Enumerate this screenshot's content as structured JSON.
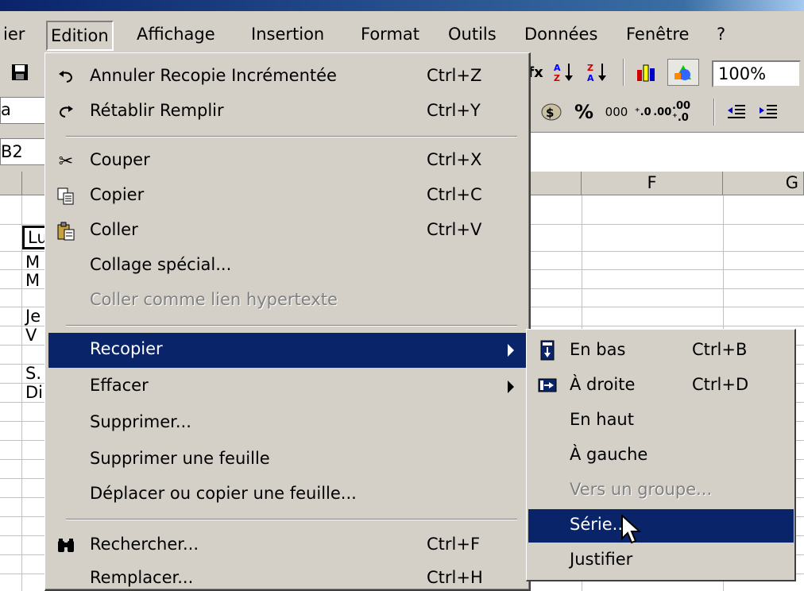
{
  "menubar": {
    "items": [
      "ier",
      "Edition",
      "Affichage",
      "Insertion",
      "Format",
      "Outils",
      "Données",
      "Fenêtre",
      "?"
    ]
  },
  "toolbar": {
    "zoom": "100%",
    "font_value": "a",
    "percent": "%",
    "thousands": "000",
    "dec_inc": "⁺.0 .00",
    "dec_dec": ".00 ⁺.0"
  },
  "namebox": {
    "value": "B2"
  },
  "columns": {
    "f": "F",
    "g": "G"
  },
  "cells": [
    "Lu",
    "M",
    "M",
    "Je",
    "V",
    "S.",
    "Di"
  ],
  "edit_menu": {
    "items": [
      {
        "label": "Annuler Recopie Incrémentée",
        "shortcut": "Ctrl+Z",
        "icon": "undo-icon"
      },
      {
        "label": "Rétablir Remplir",
        "shortcut": "Ctrl+Y",
        "icon": "redo-icon"
      },
      {
        "label": "Couper",
        "shortcut": "Ctrl+X",
        "icon": "scissors-icon"
      },
      {
        "label": "Copier",
        "shortcut": "Ctrl+C",
        "icon": "copy-icon"
      },
      {
        "label": "Coller",
        "shortcut": "Ctrl+V",
        "icon": "paste-icon"
      },
      {
        "label": "Collage spécial...",
        "shortcut": ""
      },
      {
        "label": "Coller comme lien hypertexte",
        "shortcut": "",
        "disabled": true
      },
      {
        "label": "Recopier",
        "shortcut": "",
        "submenu": true,
        "highlighted": true
      },
      {
        "label": "Effacer",
        "shortcut": "",
        "submenu": true
      },
      {
        "label": "Supprimer...",
        "shortcut": ""
      },
      {
        "label": "Supprimer une feuille",
        "shortcut": ""
      },
      {
        "label": "Déplacer ou copier une feuille...",
        "shortcut": ""
      },
      {
        "label": "Rechercher...",
        "shortcut": "Ctrl+F",
        "icon": "binoculars-icon"
      },
      {
        "label": "Remplacer...",
        "shortcut": "Ctrl+H"
      }
    ]
  },
  "fill_submenu": {
    "items": [
      {
        "label": "En bas",
        "shortcut": "Ctrl+B",
        "icon": "fill-down-icon"
      },
      {
        "label": "À droite",
        "shortcut": "Ctrl+D",
        "icon": "fill-right-icon"
      },
      {
        "label": "En haut",
        "shortcut": ""
      },
      {
        "label": "À gauche",
        "shortcut": ""
      },
      {
        "label": "Vers un groupe...",
        "shortcut": "",
        "disabled": true
      },
      {
        "label": "Série...",
        "shortcut": "",
        "highlighted": true
      },
      {
        "label": "Justifier",
        "shortcut": ""
      }
    ]
  },
  "colors": {
    "highlight": "#0a246a",
    "face": "#d4d0c8",
    "disabled": "#808080"
  }
}
